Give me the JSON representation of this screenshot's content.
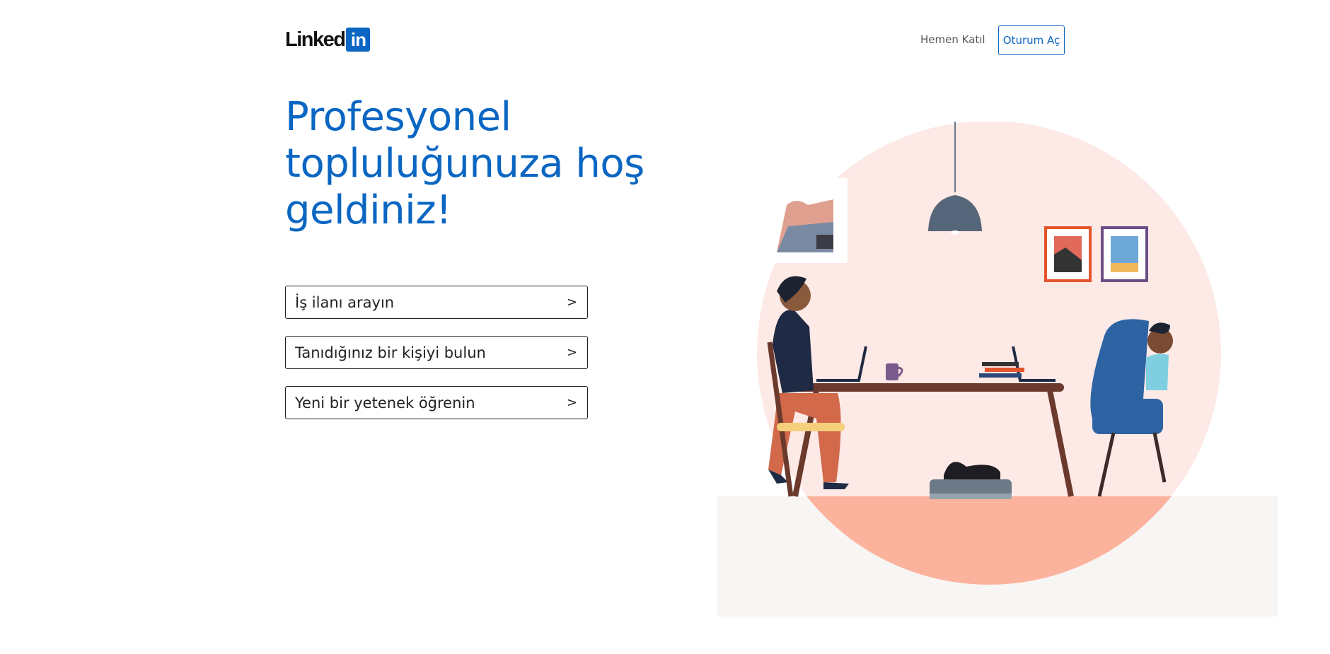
{
  "header": {
    "logo": {
      "text": "Linked",
      "badge": "in"
    },
    "join_label": "Hemen Katıl",
    "signin_label": "Oturum Aç"
  },
  "hero": {
    "line1": "Profesyonel",
    "line2": "topluluğunuza hoş",
    "line3": "geldiniz!"
  },
  "options": [
    {
      "label": "İş ilanı arayın",
      "chevron": ">"
    },
    {
      "label": "Tanıdığınız bir kişiyi bulun",
      "chevron": ">"
    },
    {
      "label": "Yeni bir yetenek öğrenin",
      "chevron": ">"
    }
  ],
  "colors": {
    "brand": "#0a66c2",
    "circle": "#fde9e5",
    "floor": "#fcb39d"
  },
  "icons": [
    "linkedin-logo",
    "chevron-right-icon"
  ]
}
